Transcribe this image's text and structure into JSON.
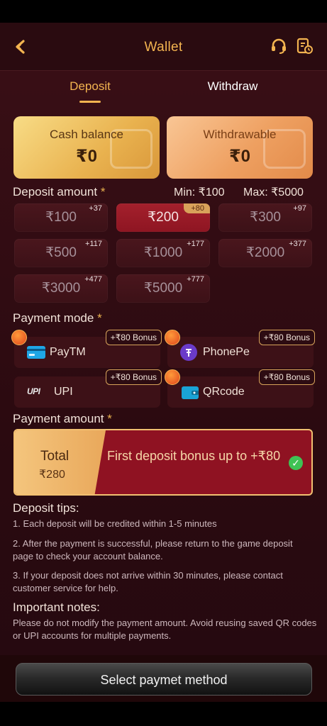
{
  "header": {
    "title": "Wallet"
  },
  "tabs": [
    {
      "label": "Deposit",
      "active": true
    },
    {
      "label": "Withdraw",
      "active": false
    }
  ],
  "balances": {
    "cash": {
      "label": "Cash balance",
      "value": "₹0"
    },
    "withdrawable": {
      "label": "Withdrawable",
      "value": "₹0"
    }
  },
  "deposit": {
    "label": "Deposit amount",
    "required_mark": "*",
    "min": "Min: ₹100",
    "max": "Max: ₹5000",
    "amounts": [
      {
        "value": "₹100",
        "bonus": "+37",
        "selected": false
      },
      {
        "value": "₹200",
        "bonus": "+80",
        "selected": true
      },
      {
        "value": "₹300",
        "bonus": "+97",
        "selected": false
      },
      {
        "value": "₹500",
        "bonus": "+117",
        "selected": false
      },
      {
        "value": "₹1000",
        "bonus": "+177",
        "selected": false
      },
      {
        "value": "₹2000",
        "bonus": "+377",
        "selected": false
      },
      {
        "value": "₹3000",
        "bonus": "+477",
        "selected": false
      },
      {
        "value": "₹5000",
        "bonus": "+777",
        "selected": false
      }
    ]
  },
  "payment_mode": {
    "label": "Payment mode",
    "required_mark": "*",
    "methods": [
      {
        "name": "PayTM",
        "bonus": "+₹80 Bonus"
      },
      {
        "name": "PhonePe",
        "bonus": "+₹80 Bonus"
      },
      {
        "name": "UPI",
        "bonus": "+₹80 Bonus",
        "logo_text": "UPI"
      },
      {
        "name": "QRcode",
        "bonus": "+₹80 Bonus"
      }
    ]
  },
  "payment_amount": {
    "label": "Payment amount",
    "required_mark": "*",
    "total_label": "Total",
    "total_value": "₹280",
    "bonus_text": "First deposit bonus up to +₹80"
  },
  "tips": {
    "heading": "Deposit tips:",
    "items": [
      "1. Each deposit will be credited within 1-5 minutes",
      "2. After the payment is successful, please return to the game deposit page to check your account balance.",
      "3. If your deposit does not arrive within 30 minutes, please contact customer service for help."
    ]
  },
  "notes": {
    "heading": "Important notes:",
    "text": "Please do not modify the payment amount. Avoid reusing saved QR codes or UPI accounts for multiple payments."
  },
  "cta": {
    "label": "Select paymet method"
  },
  "colors": {
    "accent": "#f3b450",
    "selected": "#9a1a27",
    "background": "#2b0a10"
  }
}
